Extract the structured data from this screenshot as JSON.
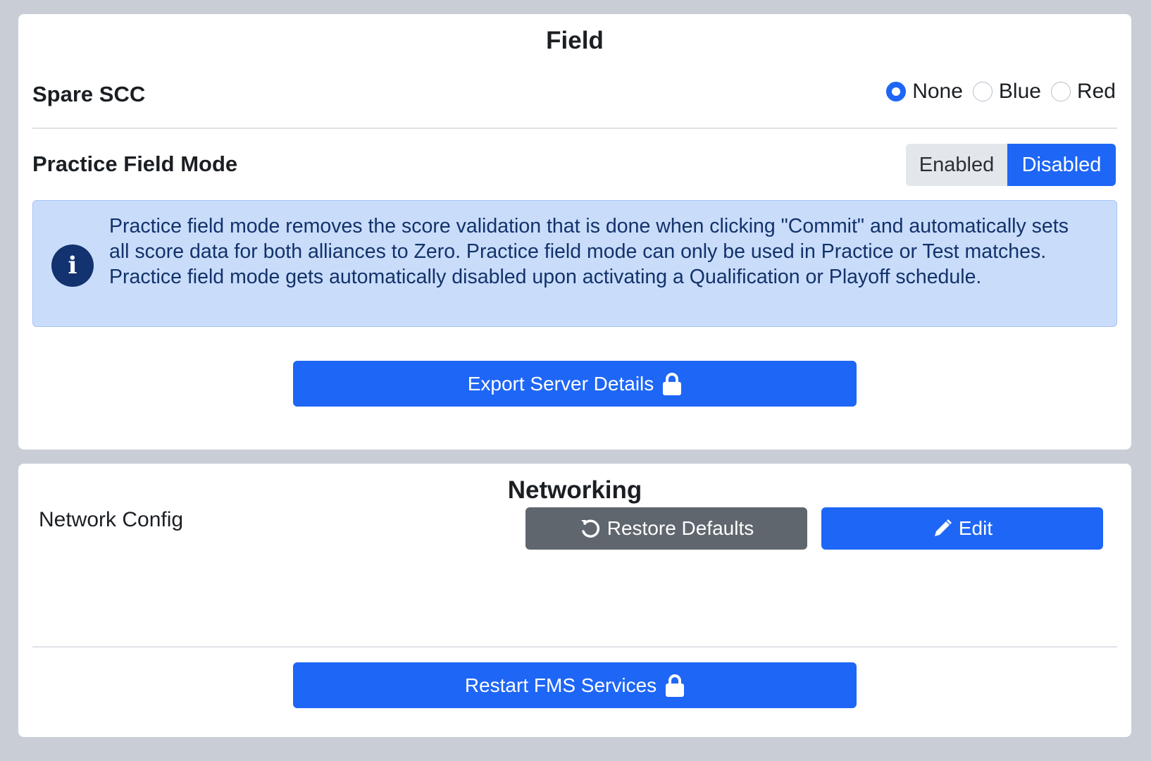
{
  "field": {
    "title": "Field",
    "spare_scc": {
      "label": "Spare SCC",
      "options": [
        "None",
        "Blue",
        "Red"
      ],
      "selected": "None"
    },
    "practice_mode": {
      "label": "Practice Field Mode",
      "enabled_label": "Enabled",
      "disabled_label": "Disabled",
      "selected": "Disabled"
    },
    "info_text": "Practice field mode removes the score validation that is done when clicking \"Commit\" and automatically sets all score data for both alliances to Zero. Practice field mode can only be used in Practice or Test matches. Practice field mode gets automatically disabled upon activating a Qualification or Playoff schedule.",
    "export_button": "Export Server Details"
  },
  "networking": {
    "title": "Networking",
    "config_label": "Network Config",
    "restore_button": "Restore Defaults",
    "edit_button": "Edit",
    "restart_button": "Restart FMS Services"
  },
  "icons": {
    "info": "info-icon",
    "lock": "lock-icon",
    "restore": "undo-icon",
    "edit": "pencil-icon"
  },
  "colors": {
    "primary": "#1e66f5",
    "secondary": "#5f666e",
    "info_bg": "#c9ddfb",
    "page_bg": "#c9ced6"
  }
}
